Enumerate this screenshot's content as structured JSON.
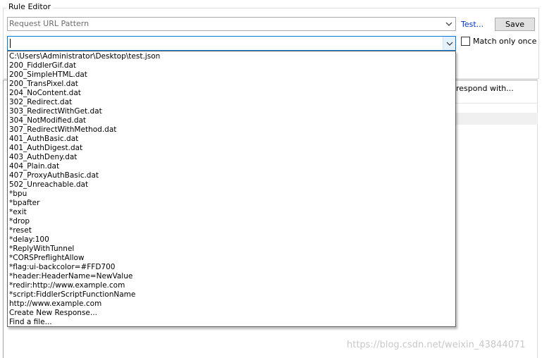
{
  "rule_editor": {
    "title": "Rule Editor",
    "match_field": {
      "value": "Request URL Pattern",
      "icon": "chevron-down-icon"
    },
    "test_link": "Test...",
    "save_label": "Save",
    "response_field": {
      "value": "",
      "icon": "chevron-down-icon"
    },
    "match_once_label": "Match only once",
    "match_once_checked": false
  },
  "lower_panel": {
    "respond_text": "respond with..."
  },
  "dropdown": {
    "items": [
      "C:\\Users\\Administrator\\Desktop\\test.json",
      "200_FiddlerGif.dat",
      "200_SimpleHTML.dat",
      "200_TransPixel.dat",
      "204_NoContent.dat",
      "302_Redirect.dat",
      "303_RedirectWithGet.dat",
      "304_NotModified.dat",
      "307_RedirectWithMethod.dat",
      "401_AuthBasic.dat",
      "401_AuthDigest.dat",
      "403_AuthDeny.dat",
      "404_Plain.dat",
      "407_ProxyAuthBasic.dat",
      "502_Unreachable.dat",
      "*bpu",
      "*bpafter",
      "*exit",
      "*drop",
      "*reset",
      "*delay:100",
      "*ReplyWithTunnel",
      "*CORSPreflightAllow",
      "*flag:ui-backcolor=#FFD700",
      "*header:HeaderName=NewValue",
      "*redir:http://www.example.com",
      "*script:FiddlerScriptFunctionName",
      "http://www.example.com",
      "Create New Response...",
      "Find a file..."
    ]
  },
  "watermark": "https://blog.csdn.net/weixin_43844071",
  "colors": {
    "link": "#0033cc",
    "focus_border": "#0078d7",
    "button_bg": "#e1e1e1"
  }
}
